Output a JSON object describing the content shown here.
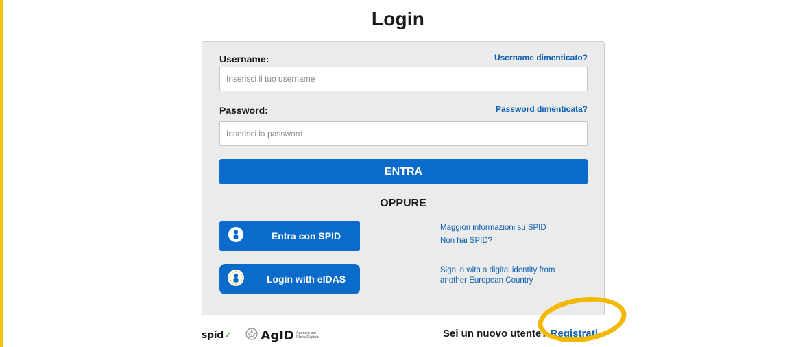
{
  "page": {
    "title": "Login"
  },
  "form": {
    "username_label": "Username:",
    "username_forgot": "Username dimenticato?",
    "username_placeholder": "Inserisci il tuo username",
    "username_value": "",
    "password_label": "Password:",
    "password_forgot": "Password dimenticata?",
    "password_placeholder": "Inserisci la password",
    "password_value": "",
    "submit_label": "ENTRA",
    "separator_label": "OPPURE"
  },
  "alt_login": {
    "spid_button": "Entra con SPID",
    "spid_icon": "user-circle-icon",
    "spid_info_link": "Maggiori informazioni su SPID",
    "spid_no_link": "Non hai SPID?",
    "eidas_button": "Login with eIDAS",
    "eidas_icon": "eu-stars-user-icon",
    "eidas_info_link": "Sign in with a digital identity from another European Country"
  },
  "footer": {
    "spid_logo_text": "spid",
    "agid_logo_text": "AgID",
    "agid_logo_subtext": "Agenzia per l'Italia Digitale",
    "signup_prompt": "Sei un nuovo utente?",
    "signup_link": "Registrati"
  },
  "colors": {
    "accent_yellow": "#f3c200",
    "primary_blue": "#0b6bcb",
    "link_blue": "#0b5fb3",
    "card_bg": "#ebebeb"
  }
}
